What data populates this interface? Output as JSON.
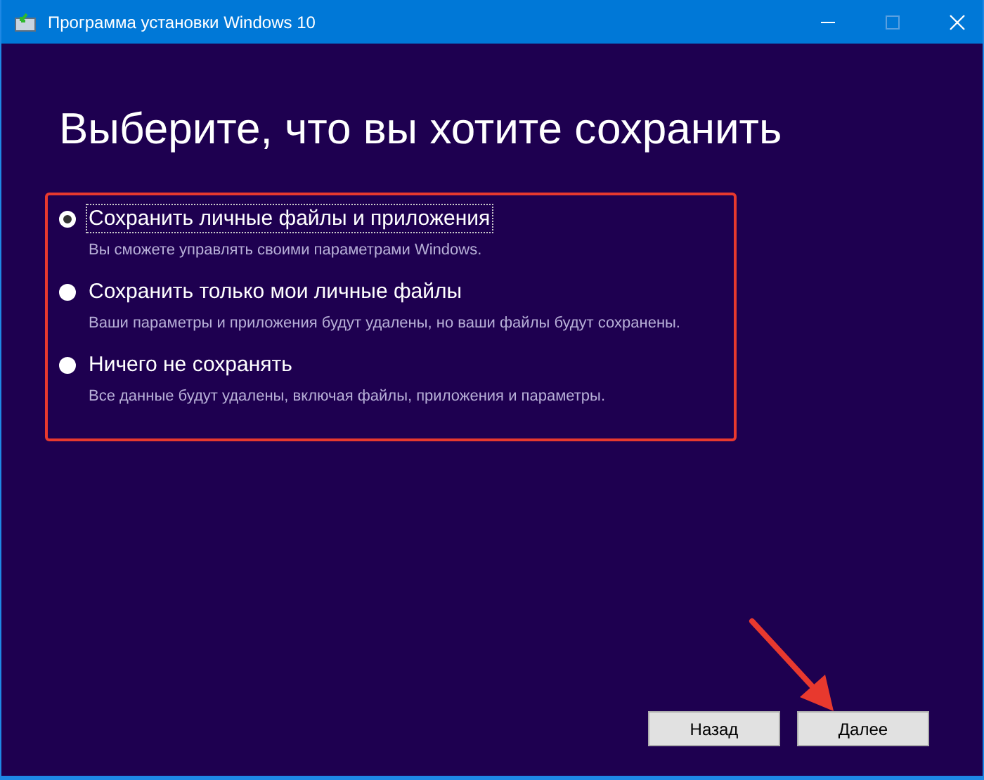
{
  "window": {
    "title": "Программа установки Windows 10"
  },
  "heading": "Выберите, что вы хотите сохранить",
  "options": [
    {
      "label": "Сохранить личные файлы и приложения",
      "description": "Вы сможете управлять своими параметрами Windows.",
      "selected": true
    },
    {
      "label": "Сохранить только мои личные файлы",
      "description": "Ваши параметры и приложения будут удалены, но ваши файлы будут сохранены.",
      "selected": false
    },
    {
      "label": "Ничего не сохранять",
      "description": "Все данные будут удалены, включая файлы, приложения и параметры.",
      "selected": false
    }
  ],
  "buttons": [
    "Назад",
    "Далее"
  ]
}
